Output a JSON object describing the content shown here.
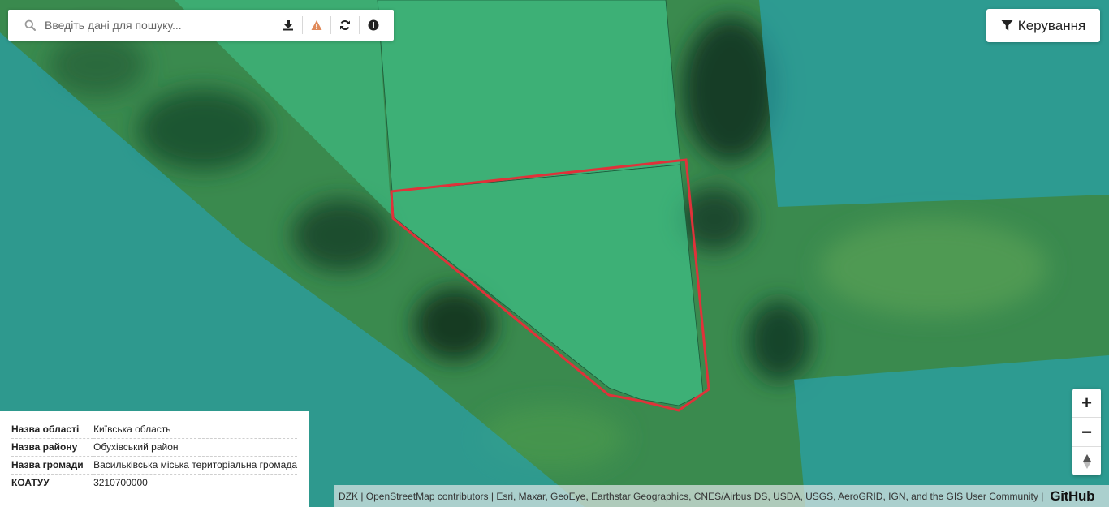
{
  "search": {
    "placeholder": "Введіть дані для пошуку..."
  },
  "toolbar": {
    "icons": [
      "download-icon",
      "warning-icon",
      "refresh-icon",
      "info-icon"
    ],
    "warning_color": "#e08a5a"
  },
  "control_button": {
    "label": "Керування",
    "icon": "filter-icon"
  },
  "zoom": {
    "in": "+",
    "out": "−",
    "north": "▲"
  },
  "parcel_info": {
    "rows": [
      {
        "key": "Назва області",
        "value": "Київська область"
      },
      {
        "key": "Назва району",
        "value": "Обухівський район"
      },
      {
        "key": "Назва громади",
        "value": "Васильківська міська територіальна громада"
      },
      {
        "key": "КОАТУУ",
        "value": "3210700000"
      }
    ]
  },
  "attribution": {
    "text": "DZK | OpenStreetMap contributors | Esri, Maxar, GeoEye, Earthstar Geographics, CNES/Airbus DS, USDA, USGS, AeroGRID, IGN, and the GIS User Community |",
    "github": "GitHub"
  },
  "colors": {
    "parcel_fill": "#3fbf86",
    "selected_outline": "#e0323a",
    "overlay_teal": "#2a9aa0",
    "imagery_green": "#2f7a4a"
  }
}
